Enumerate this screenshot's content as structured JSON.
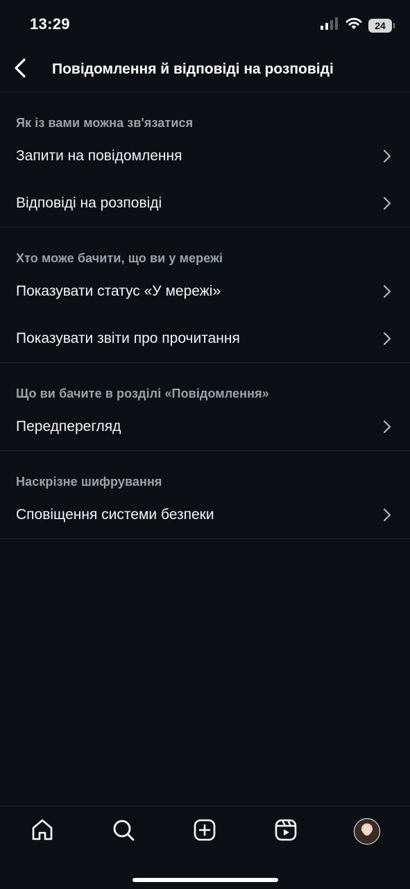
{
  "status_bar": {
    "time": "13:29",
    "battery": "24",
    "icons": [
      "cellular-signal-icon",
      "wifi-icon",
      "battery-icon"
    ]
  },
  "header": {
    "back_icon": "chevron-left-icon",
    "title": "Повідомлення й відповіді на розповіді"
  },
  "sections": [
    {
      "title": "Як із вами можна зв'язатися",
      "items": [
        {
          "label": "Запити на повідомлення"
        },
        {
          "label": "Відповіді на розповіді"
        }
      ]
    },
    {
      "title": "Хто може бачити, що ви у мережі",
      "items": [
        {
          "label": "Показувати статус «У мережі»"
        },
        {
          "label": "Показувати звіти про прочитання"
        }
      ]
    },
    {
      "title": "Що ви бачите в розділі «Повідомлення»",
      "items": [
        {
          "label": "Передперегляд"
        }
      ]
    },
    {
      "title": "Наскрізне шифрування",
      "items": [
        {
          "label": "Сповіщення системи безпеки"
        }
      ]
    }
  ],
  "tab_bar": {
    "tabs": [
      "home-icon",
      "search-icon",
      "create-icon",
      "reels-icon",
      "profile-avatar"
    ]
  },
  "colors": {
    "background": "#0c0f14",
    "text": "#f5f5f5",
    "section_title": "#9ea3ab",
    "divider": "#1f232a"
  }
}
